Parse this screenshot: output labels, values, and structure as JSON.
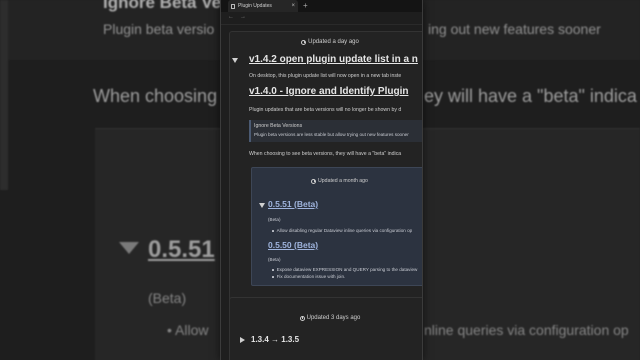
{
  "background": {
    "title": "Ignore Beta Vers",
    "subtitle": "Plugin beta versio",
    "subtitle_right": "ing out new features sooner",
    "when_text": "When choosing",
    "when_right": "ey will have a \"beta\" indica",
    "version": "0.5.51",
    "beta": "(Beta)",
    "bullet": "Allow",
    "bullet_right": "nline queries via configuration op"
  },
  "window": {
    "tab_label": "Plugin Updates",
    "tab_close": "×",
    "new_tab": "+",
    "nav_back": "←",
    "nav_forward": "→"
  },
  "release_1": {
    "updated": "Updated a day ago",
    "heading": "v1.4.2 open plugin update list in a n",
    "desc": "On desktop, this plugin update list will now open in a new tab inste",
    "heading2": "v1.4.0 - Ignore and Identify Plugin",
    "desc2": "Plugin updates that are beta versions will no longer be shown by d",
    "callout_title": "Ignore Beta Versions",
    "callout_text": "Plugin beta versions are less stable but allow trying out new features sooner",
    "when_text": "When choosing to see beta versions, they will have a \"beta\" indica"
  },
  "nested": {
    "updated": "Updated a month ago",
    "v1": "0.5.51 (Beta)",
    "v1_beta": "(Beta)",
    "v1_item": "Allow disabling regular Dataview inline queries via configuration op",
    "v2": "0.5.50 (Beta)",
    "v2_beta": "(Beta)",
    "v2_item1": "Expose dataview EXPRESSION and QUERY parsing to the dataview",
    "v2_item2": "Fix documentation issue with join."
  },
  "release_2": {
    "updated": "Updated 3 days ago",
    "heading": "1.3.4 → 1.3.5"
  }
}
